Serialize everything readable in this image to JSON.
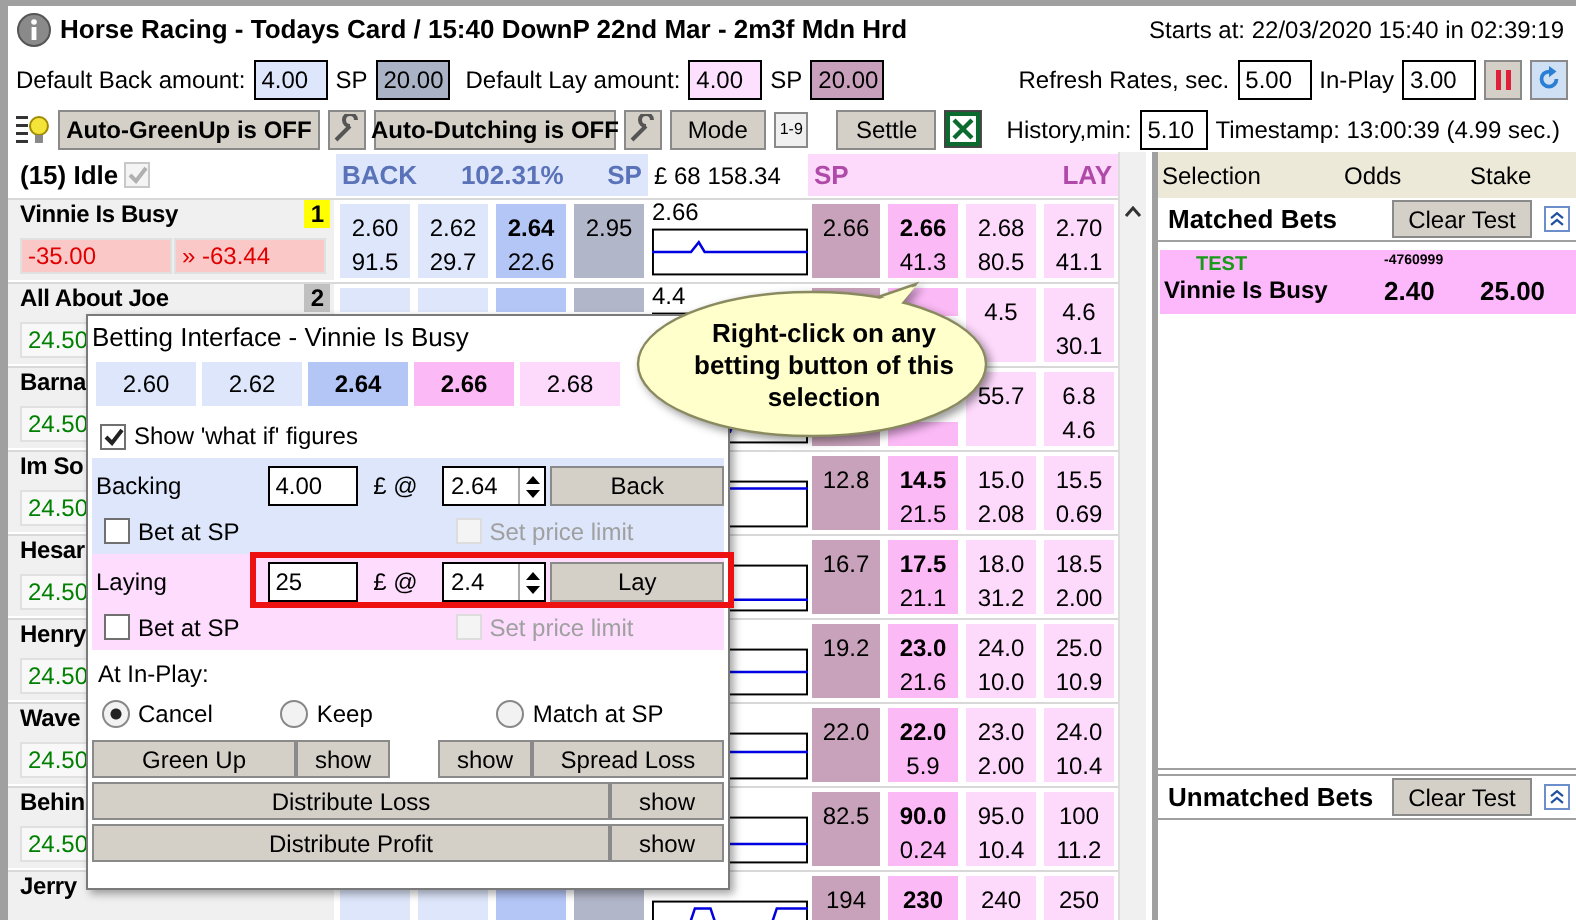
{
  "title": "Horse Racing - Todays Card / 15:40 DownP 22nd Mar - 2m3f Mdn Hrd",
  "starts": "Starts at: 22/03/2020 15:40 in 02:39:19",
  "defaults": {
    "back_label": "Default Back amount:",
    "back_value": "4.00",
    "back_sp_label": "SP",
    "back_sp_value": "20.00",
    "lay_label": "Default Lay amount:",
    "lay_value": "4.00",
    "lay_sp_label": "SP",
    "lay_sp_value": "20.00"
  },
  "refresh": {
    "label": "Refresh Rates, sec.",
    "value": "5.00",
    "inplay_label": "In-Play",
    "inplay_value": "3.00"
  },
  "toolbar": {
    "greenup": "Auto-GreenUp is OFF",
    "dutching": "Auto-Dutching is OFF",
    "mode": "Mode",
    "odds_icon": "1-9",
    "settle": "Settle",
    "history_label": "History,min:",
    "history_value": "5.10",
    "timestamp": "Timestamp: 13:00:39 (4.99 sec.)"
  },
  "market": {
    "status": "(15) Idle",
    "status_checkbox": {
      "checked": true,
      "disabled": true
    },
    "back_header": "BACK",
    "book": "102.31%",
    "back_sp": "SP",
    "matched": "£ 68 158.34",
    "lay_sp": "SP",
    "lay_header": "LAY"
  },
  "runners": [
    {
      "name": "Vinnie Is Busy",
      "badge": {
        "text": "1",
        "color": "#ffff00"
      },
      "pl": [
        {
          "text": "-35.00",
          "loss": true
        },
        {
          "text": "» -63.44",
          "loss": true
        }
      ],
      "back_1": {
        "price": "2.60",
        "size": "91.5"
      },
      "back_2": {
        "price": "2.62",
        "size": "29.7"
      },
      "back_3": {
        "price": "2.64",
        "size": "22.6"
      },
      "sp_back": "2.95",
      "chart_label": "2.66",
      "sp_lay": "2.66",
      "lay_1": {
        "price": "2.66",
        "size": "41.3"
      },
      "lay_2": {
        "price": "2.68",
        "size": "80.5"
      },
      "lay_3": {
        "price": "2.70",
        "size": "41.1"
      }
    },
    {
      "name": "All About Joe",
      "badge": {
        "text": "2",
        "color": "#c0c0c0"
      },
      "pl": [
        {
          "text": "24.50",
          "loss": false
        }
      ],
      "chart_label": "4.4",
      "lay_2": {
        "price": "4.5"
      },
      "lay_3": {
        "price": "4.6",
        "size": "30.1"
      }
    },
    {
      "name": "Barna",
      "pl": [
        {
          "text": "24.50",
          "loss": false
        }
      ],
      "lay_2": {
        "size": "55.7"
      },
      "lay_3": {
        "price": "6.8",
        "size": "4.6"
      }
    },
    {
      "name": "Im So",
      "pl": [
        {
          "text": "24.50",
          "loss": false
        }
      ],
      "sp_lay": "12.8",
      "lay_1": {
        "price": "14.5",
        "size": "21.5"
      },
      "lay_2": {
        "price": "15.0",
        "size": "2.08"
      },
      "lay_3": {
        "price": "15.5",
        "size": "0.69"
      }
    },
    {
      "name": "Hesar",
      "pl": [
        {
          "text": "24.50",
          "loss": false
        }
      ],
      "sp_lay": "16.7",
      "lay_1": {
        "price": "17.5",
        "size": "21.1"
      },
      "lay_2": {
        "price": "18.0",
        "size": "31.2"
      },
      "lay_3": {
        "price": "18.5",
        "size": "2.00"
      }
    },
    {
      "name": "Henry",
      "pl": [
        {
          "text": "24.50",
          "loss": false
        }
      ],
      "sp_lay": "19.2",
      "lay_1": {
        "price": "23.0",
        "size": "21.6"
      },
      "lay_2": {
        "price": "24.0",
        "size": "10.0"
      },
      "lay_3": {
        "price": "25.0",
        "size": "10.9"
      }
    },
    {
      "name": "Wave",
      "pl": [
        {
          "text": "24.50",
          "loss": false
        }
      ],
      "sp_lay": "22.0",
      "lay_1": {
        "price": "22.0",
        "size": "5.9"
      },
      "lay_2": {
        "price": "23.0",
        "size": "2.00"
      },
      "lay_3": {
        "price": "24.0",
        "size": "10.4"
      }
    },
    {
      "name": "Behin",
      "pl": [
        {
          "text": "24.50",
          "loss": false
        }
      ],
      "sp_lay": "82.5",
      "lay_1": {
        "price": "90.0",
        "size": "0.24"
      },
      "lay_2": {
        "price": "95.0",
        "size": "10.4"
      },
      "lay_3": {
        "price": "100",
        "size": "11.2"
      }
    },
    {
      "name": "Jerry",
      "sp_lay": "194",
      "lay_1": {
        "price": "230"
      },
      "lay_2": {
        "price": "240"
      },
      "lay_3": {
        "price": "250"
      }
    }
  ],
  "bets": {
    "columns": [
      "Selection",
      "Odds",
      "Stake"
    ],
    "matched": {
      "title": "Matched Bets",
      "button": "Clear Test",
      "items": [
        {
          "tag": "TEST",
          "id": "-4760999",
          "selection": "Vinnie Is Busy",
          "odds": "2.40",
          "stake": "25.00"
        }
      ]
    },
    "unmatched": {
      "title": "Unmatched Bets",
      "button": "Clear Test"
    }
  },
  "dialog": {
    "title": "Betting Interface - Vinnie Is Busy",
    "prices": [
      {
        "text": "2.60",
        "kind": "back"
      },
      {
        "text": "2.62",
        "kind": "back"
      },
      {
        "text": "2.64",
        "kind": "back_best"
      },
      {
        "text": "2.66",
        "kind": "lay_best"
      },
      {
        "text": "2.68",
        "kind": "lay"
      }
    ],
    "what_if": {
      "label": "Show 'what if' figures",
      "checked": true
    },
    "sections": [
      {
        "kind": "back",
        "label": "Backing",
        "stake": "4.00",
        "unit": "£ @",
        "price": "2.64",
        "button": "Back",
        "highlighted": false,
        "bet_at_sp": {
          "label": "Bet at SP",
          "checked": false
        },
        "price_limit": {
          "label": "Set price limit",
          "checked": false,
          "disabled": true
        }
      },
      {
        "kind": "lay",
        "label": "Laying",
        "stake": "25",
        "unit": "£ @",
        "price": "2.4",
        "button": "Lay",
        "highlighted": true,
        "bet_at_sp": {
          "label": "Bet at SP",
          "checked": false
        },
        "price_limit": {
          "label": "Set price limit",
          "checked": false,
          "disabled": true
        }
      }
    ],
    "inplay": {
      "label": "At In-Play:",
      "options": [
        {
          "label": "Cancel",
          "selected": true
        },
        {
          "label": "Keep",
          "selected": false
        },
        {
          "label": "Match at SP",
          "selected": false
        }
      ]
    },
    "green_up": {
      "button": "Green Up",
      "show": "show"
    },
    "spread_loss": {
      "show": "show",
      "button": "Spread Loss"
    },
    "distribute_loss": {
      "button": "Distribute Loss",
      "show": "show"
    },
    "distribute_profit": {
      "button": "Distribute Profit",
      "show": "show"
    }
  },
  "callout": "Right-click on any betting button of this selection"
}
